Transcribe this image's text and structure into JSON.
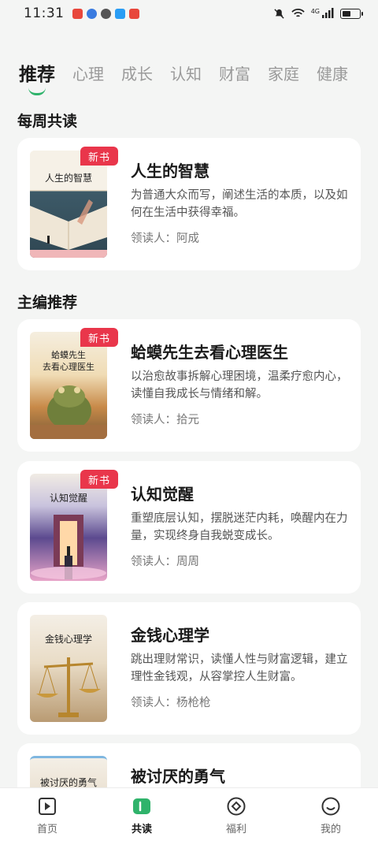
{
  "status_bar": {
    "time": "11:31",
    "network_label": "4G"
  },
  "tabs": [
    {
      "label": "推荐",
      "active": true
    },
    {
      "label": "心理",
      "active": false
    },
    {
      "label": "成长",
      "active": false
    },
    {
      "label": "认知",
      "active": false
    },
    {
      "label": "财富",
      "active": false
    },
    {
      "label": "家庭",
      "active": false
    },
    {
      "label": "健康",
      "active": false
    }
  ],
  "weekly": {
    "section_title": "每周共读",
    "books": [
      {
        "title": "人生的智慧",
        "cover_title": "人生的智慧",
        "badge": "新书",
        "description": "为普通大众而写，阐述生活的本质，以及如何在生活中获得幸福。",
        "reader": "领读人：阿成"
      }
    ]
  },
  "editor": {
    "section_title": "主编推荐",
    "books": [
      {
        "title": "蛤蟆先生去看心理医生",
        "cover_title": "蛤蟆先生\n去看心理医生",
        "badge": "新书",
        "description": "以治愈故事拆解心理困境，温柔疗愈内心，读懂自我成长与情绪和解。",
        "reader": "领读人：拾元"
      },
      {
        "title": "认知觉醒",
        "cover_title": "认知觉醒",
        "badge": "新书",
        "description": "重塑底层认知，摆脱迷茫内耗，唤醒内在力量，实现终身自我蜕变成长。",
        "reader": "领读人：周周"
      },
      {
        "title": "金钱心理学",
        "cover_title": "金钱心理学",
        "badge": "",
        "description": "跳出理财常识，读懂人性与财富逻辑，建立理性金钱观，从容掌控人生财富。",
        "reader": "领读人：杨枪枪"
      },
      {
        "title": "被讨厌的勇气",
        "cover_title": "被讨厌的勇气",
        "badge": "",
        "description": "",
        "reader": ""
      }
    ]
  },
  "bottom_nav": [
    {
      "label": "首页",
      "icon": "play-icon",
      "active": false
    },
    {
      "label": "共读",
      "icon": "book-icon",
      "active": true
    },
    {
      "label": "福利",
      "icon": "gift-icon",
      "active": false
    },
    {
      "label": "我的",
      "icon": "smile-icon",
      "active": false
    }
  ],
  "colors": {
    "accent": "#2fb36b",
    "badge": "#e9364b",
    "background": "#f4f5f4"
  }
}
